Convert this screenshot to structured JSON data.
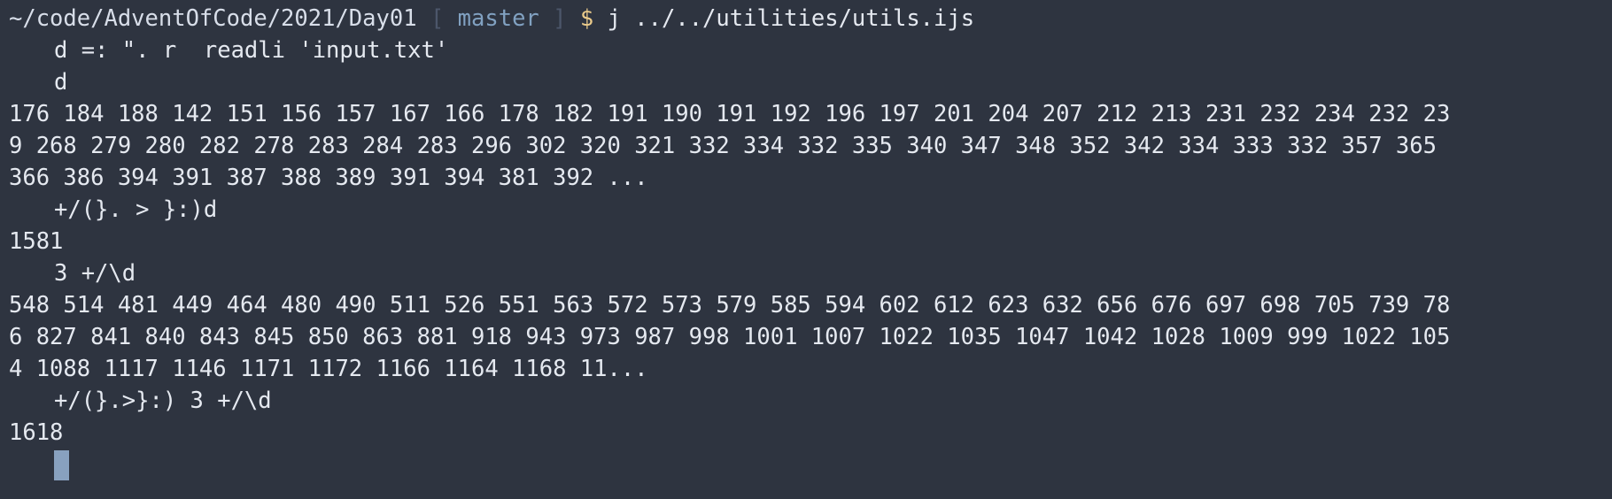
{
  "prompt": {
    "path": "~/code/AdventOfCode/2021/Day01",
    "bracket_open": "[",
    "branch": "master",
    "bracket_close": "]",
    "symbol": "$",
    "command": "j ../../utilities/utils.ijs"
  },
  "lines": [
    {
      "type": "input",
      "text": "d =: \". r  readli 'input.txt'"
    },
    {
      "type": "input",
      "text": "d"
    },
    {
      "type": "output",
      "text": "176 184 188 142 151 156 157 167 166 178 182 191 190 191 192 196 197 201 204 207 212 213 231 232 234 232 23"
    },
    {
      "type": "output",
      "text": "9 268 279 280 282 278 283 284 283 296 302 320 321 332 334 332 335 340 347 348 352 342 334 333 332 357 365"
    },
    {
      "type": "output",
      "text": "366 386 394 391 387 388 389 391 394 381 392 ..."
    },
    {
      "type": "input",
      "text": "+/(}. > }:)d"
    },
    {
      "type": "output",
      "text": "1581"
    },
    {
      "type": "input",
      "text": "3 +/\\d"
    },
    {
      "type": "output",
      "text": "548 514 481 449 464 480 490 511 526 551 563 572 573 579 585 594 602 612 623 632 656 676 697 698 705 739 78"
    },
    {
      "type": "output",
      "text": "6 827 841 840 843 845 850 863 881 918 943 973 987 998 1001 1007 1022 1035 1047 1042 1028 1009 999 1022 105"
    },
    {
      "type": "output",
      "text": "4 1088 1117 1146 1171 1172 1166 1164 1168 11..."
    },
    {
      "type": "input",
      "text": "+/(}.>}:) 3 +/\\d"
    },
    {
      "type": "output",
      "text": "1618"
    }
  ],
  "colors": {
    "background": "#2e3440",
    "foreground": "#e5e9f0",
    "branch": "#81a1c1",
    "bracket": "#4c566a",
    "dollar": "#ebcb8b",
    "cursor": "#88a1bf"
  }
}
